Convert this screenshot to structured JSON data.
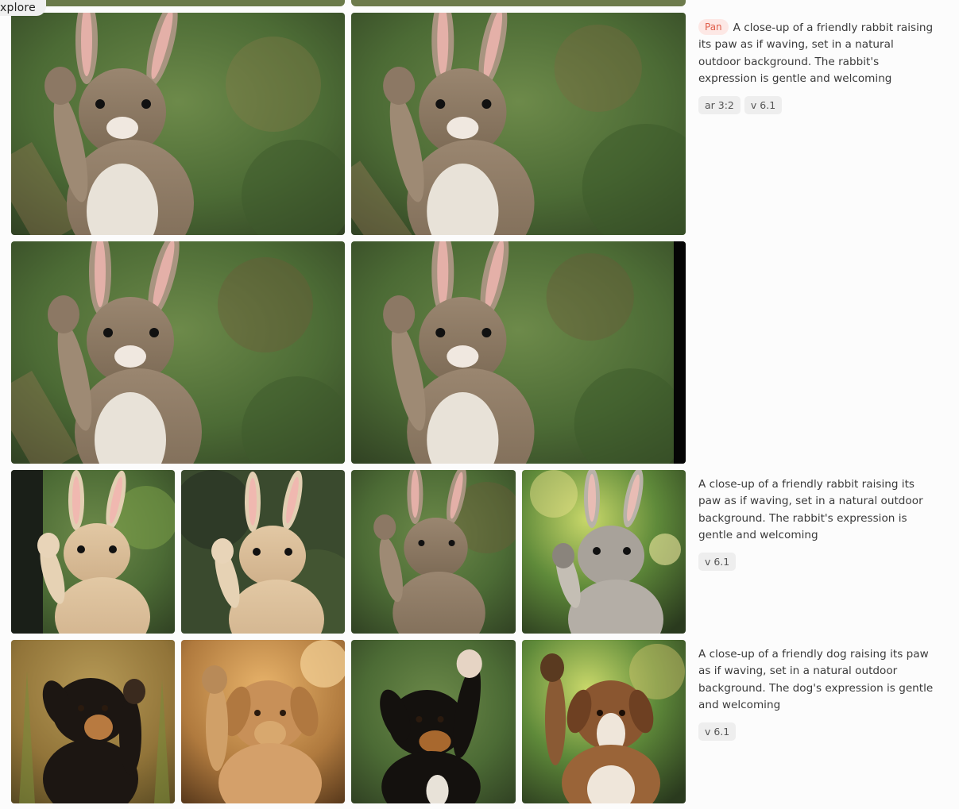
{
  "nav": {
    "explore_label": "Explore"
  },
  "jobs": [
    {
      "badge": "Pan",
      "prompt": "A close-up of a friendly rabbit raising its paw as if waving, set in a natural outdoor background. The rabbit's expression is gentle and welcoming",
      "params": [
        "ar 3:2",
        "v 6.1"
      ]
    },
    {
      "prompt": "A close-up of a friendly rabbit raising its paw as if waving, set in a natural outdoor background. The rabbit's expression is gentle and welcoming",
      "params": [
        "v 6.1"
      ]
    },
    {
      "prompt": "A close-up of a friendly dog raising its paw as if waving, set in a natural outdoor background. The dog's expression is gentle and welcoming",
      "params": [
        "v 6.1"
      ]
    }
  ],
  "image_subjects": {
    "row1": [
      "brown-rabbit-waving",
      "brown-rabbit-waving",
      "brown-rabbit-waving",
      "brown-rabbit-waving"
    ],
    "row2": [
      "tan-rabbit-waving",
      "tan-rabbit-waving",
      "brown-rabbit-waving",
      "grey-rabbit-waving"
    ],
    "row3": [
      "black-tan-dog-waving",
      "golden-dog-waving",
      "black-tan-dog-waving",
      "brown-white-dog-waving"
    ]
  },
  "colors": {
    "pan_badge_bg": "#fde8e5",
    "pan_badge_text": "#e0604c",
    "chip_bg": "#eeeeee"
  }
}
